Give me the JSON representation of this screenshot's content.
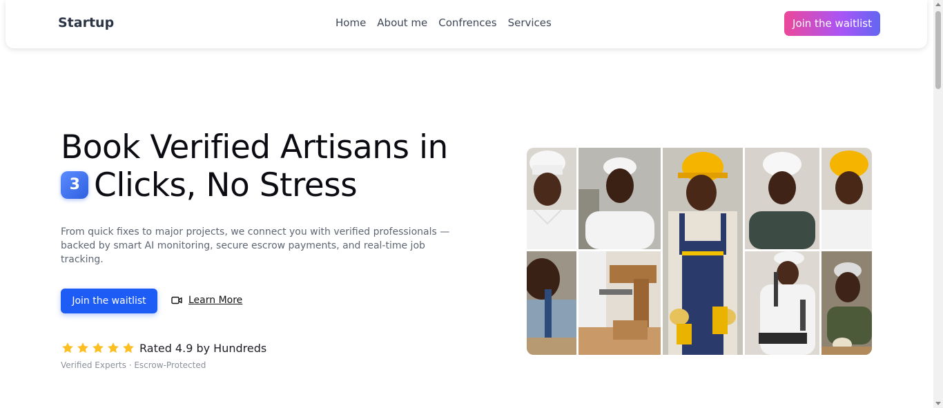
{
  "nav": {
    "brand": "Startup",
    "links": [
      "Home",
      "About me",
      "Confrences",
      "Services"
    ],
    "cta": "Join the waitlist"
  },
  "hero": {
    "headline_line1": "Book Verified Artisans in",
    "badge_number": "3",
    "headline_line2": "Clicks, No Stress",
    "subtext": "From quick fixes to major projects, we connect you with verified professionals — backed by smart AI monitoring, secure escrow payments, and real-time job tracking.",
    "primary_button": "Join the waitlist",
    "secondary_button": "Learn More",
    "secondary_icon": "video-camera-icon",
    "rating_stars": 5,
    "rating_text": "Rated 4.9 by Hundreds",
    "footnote": "Verified Experts · Escrow-Protected"
  },
  "colors": {
    "accent_blue": "#1d5cf5",
    "cta_gradient_start": "#ec4899",
    "cta_gradient_end": "#6366f1",
    "star": "#fbbf24"
  },
  "collage": {
    "images": [
      "chef-white-hat-photo",
      "chef-woman-white-cap-photo",
      "construction-worker-hard-hat-overalls-photo",
      "chef-woman-dark-uniform-photo",
      "worker-hard-hat-chef-coat-photo",
      "woman-artisan-workshop-photo",
      "carpenter-wood-clamp-photo",
      "chef-working-tools-photo",
      "artisan-grey-cap-workshop-photo"
    ]
  }
}
